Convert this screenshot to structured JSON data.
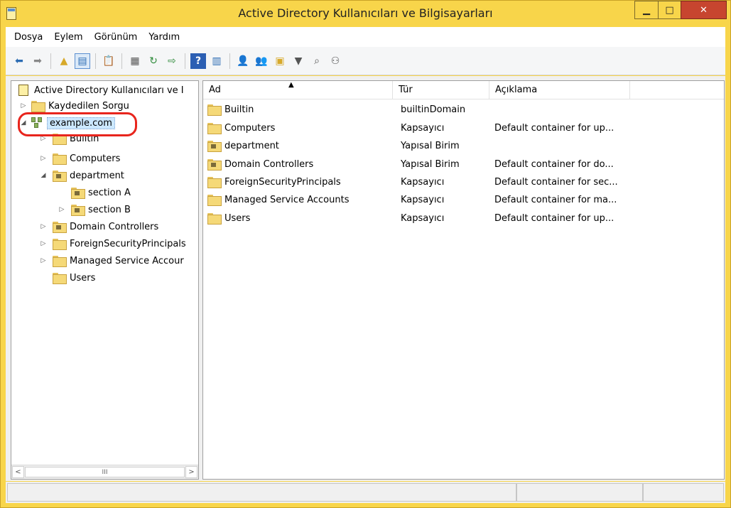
{
  "window": {
    "title": "Active Directory Kullanıcıları ve Bilgisayarları"
  },
  "menu": [
    "Dosya",
    "Eylem",
    "Görünüm",
    "Yardım"
  ],
  "tree": {
    "root": "Active Directory Kullanıcıları ve I",
    "saved_queries": "Kaydedilen Sorgu",
    "domain": "example.com",
    "children": [
      {
        "label": "Builtin"
      },
      {
        "label": "Computers"
      },
      {
        "label": "department"
      },
      {
        "label": "section A"
      },
      {
        "label": "section B"
      },
      {
        "label": "Domain Controllers"
      },
      {
        "label": "ForeignSecurityPrincipals"
      },
      {
        "label": "Managed Service Accour"
      },
      {
        "label": "Users"
      }
    ],
    "scroll_thumb": "III"
  },
  "list": {
    "columns": [
      "Ad",
      "Tür",
      "Açıklama"
    ],
    "rows": [
      {
        "name": "Builtin",
        "type": "builtinDomain",
        "desc": ""
      },
      {
        "name": "Computers",
        "type": "Kapsayıcı",
        "desc": "Default container for up..."
      },
      {
        "name": "department",
        "type": "Yapısal Birim",
        "desc": ""
      },
      {
        "name": "Domain Controllers",
        "type": "Yapısal Birim",
        "desc": "Default container for do..."
      },
      {
        "name": "ForeignSecurityPrincipals",
        "type": "Kapsayıcı",
        "desc": "Default container for sec..."
      },
      {
        "name": "Managed Service Accounts",
        "type": "Kapsayıcı",
        "desc": "Default container for ma..."
      },
      {
        "name": "Users",
        "type": "Kapsayıcı",
        "desc": "Default container for up..."
      }
    ]
  },
  "icons": {
    "back": "back-arrow-icon",
    "forward": "forward-arrow-icon"
  },
  "colors": {
    "titlebar": "#f8d54a",
    "close": "#c7452f",
    "highlight": "#e8251d"
  }
}
